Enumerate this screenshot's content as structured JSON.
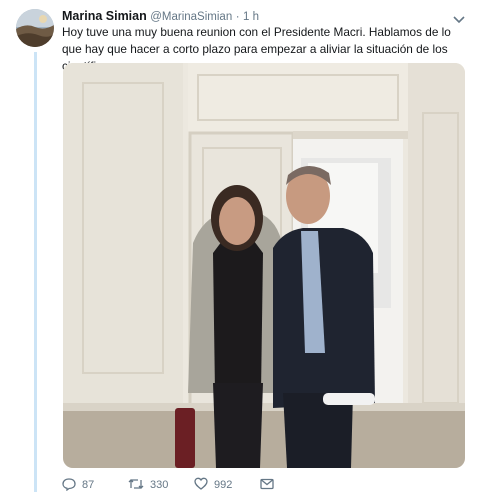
{
  "tweet": {
    "author_name": "Marina Simian",
    "author_handle": "@MarinaSimian",
    "separator": "·",
    "time": "1 h",
    "text": "Hoy tuve una muy buena reunion con el Presidente Macri. Hablamos de lo que hay que hacer a corto plazo para empezar a aliviar la situación de los científicos.",
    "actions": {
      "replies": "87",
      "retweets": "330",
      "likes": "992"
    }
  },
  "icons": {
    "reply": "reply-icon",
    "retweet": "retweet-icon",
    "like": "heart-icon",
    "message": "envelope-icon",
    "menu": "chevron-down-icon"
  },
  "colors": {
    "text": "#14171a",
    "secondary": "#657786",
    "thread_line": "#cce4f6"
  }
}
